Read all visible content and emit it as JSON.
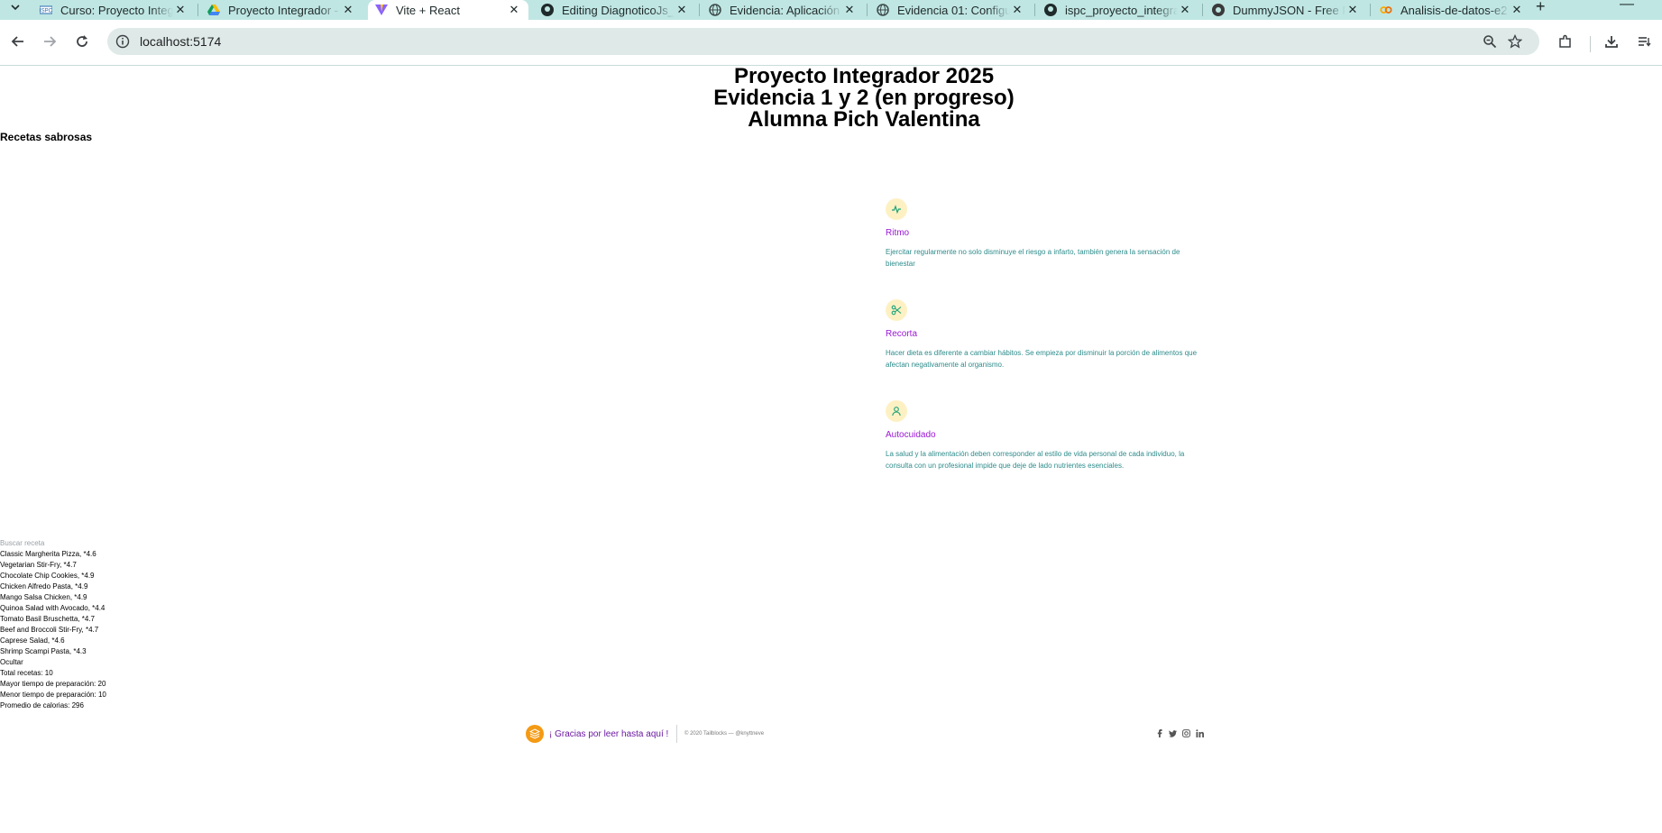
{
  "browser": {
    "tabs": [
      {
        "title": "Curso: Proyecto Integ",
        "favicon": "ispc-favicon",
        "active": false
      },
      {
        "title": "Proyecto Integrador -",
        "favicon": "google-drive-favicon",
        "active": false
      },
      {
        "title": "Vite + React",
        "favicon": "vite-favicon",
        "active": true
      },
      {
        "title": "Editing DiagnoticoJs_",
        "favicon": "github-favicon",
        "active": false
      },
      {
        "title": "Evidencia: Aplicación",
        "favicon": "globe-favicon",
        "active": false
      },
      {
        "title": "Evidencia 01: Configu",
        "favicon": "globe-favicon",
        "active": false
      },
      {
        "title": "ispc_proyecto_integra",
        "favicon": "github-favicon",
        "active": false
      },
      {
        "title": "DummyJSON - Free F",
        "favicon": "dummyjson-favicon",
        "active": false
      },
      {
        "title": "Analisis-de-datos-e2",
        "favicon": "colab-favicon",
        "active": false
      }
    ],
    "address": "localhost:5174"
  },
  "header": {
    "line1": "Proyecto Integrador 2025",
    "line2": "Evidencia 1 y 2 (en progreso)",
    "line3": "Alumna Pich Valentina"
  },
  "subtitle": "Recetas sabrosas",
  "features": [
    {
      "icon": "pulse-icon",
      "title": "Ritmo",
      "desc": "Ejercitar regularmente no solo disminuye el riesgo a infarto, también genera la sensación de bienestar"
    },
    {
      "icon": "scissors-icon",
      "title": "Recorta",
      "desc": "Hacer dieta es diferente a cambiar hábitos. Se empieza por disminuir la porción de alimentos que afectan negativamente al organismo."
    },
    {
      "icon": "user-icon",
      "title": "Autocuidado",
      "desc": "La salud y la alimentación deben corresponder al estilo de vida personal de cada individuo, la consulta con un profesional impide que deje de lado nutrientes esenciales."
    }
  ],
  "recipes": {
    "search_placeholder": "Buscar receta",
    "items": [
      "Classic Margherita Pizza, *4.6",
      "Vegetarian Stir-Fry, *4.7",
      "Chocolate Chip Cookies, *4.9",
      "Chicken Alfredo Pasta, *4.9",
      "Mango Salsa Chicken, *4.9",
      "Quinoa Salad with Avocado, *4.4",
      "Tomato Basil Bruschetta, *4.7",
      "Beef and Broccoli Stir-Fry, *4.7",
      "Caprese Salad, *4.6",
      "Shrimp Scampi Pasta, *4.3"
    ],
    "hide_label": "Ocultar",
    "stats": [
      "Total recetas: 10",
      "Mayor tiempo de preparación: 20",
      "Menor tiempo de preparación: 10",
      "Promedio de calorias: 296"
    ]
  },
  "footer": {
    "brand": "¡ Gracias por leer hasta aquí !",
    "copyright": "© 2020 Tailblocks — @knyttneve",
    "social": [
      "facebook-icon",
      "twitter-icon",
      "instagram-icon",
      "linkedin-icon"
    ]
  },
  "colors": {
    "tabstrip": "#bfe6e3",
    "feature_title": "#9b17d6",
    "feature_desc": "#2e8b8b",
    "feature_icon_bg": "#fdf1c4",
    "footer_logo": "#f49a14",
    "footer_brand": "#6b1aa0"
  }
}
